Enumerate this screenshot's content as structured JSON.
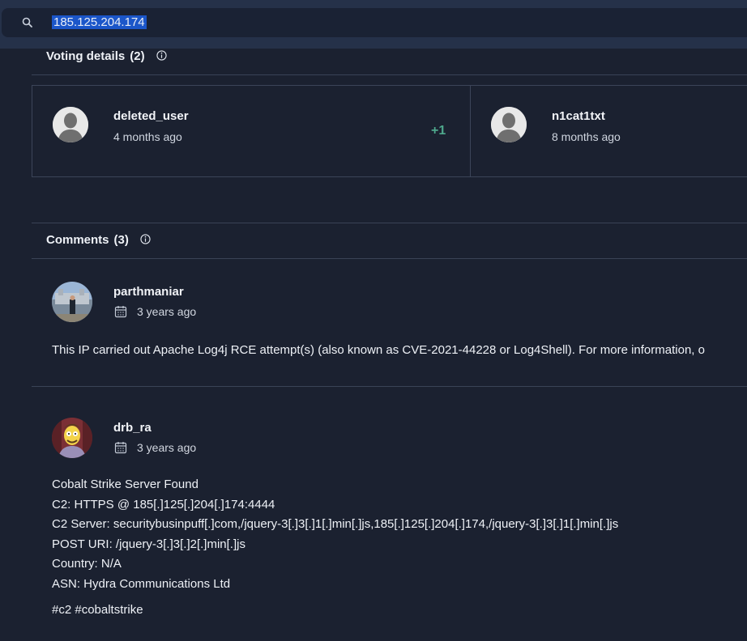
{
  "search": {
    "query": "185.125.204.174"
  },
  "voting": {
    "title": "Voting details",
    "count": "(2)",
    "cards": [
      {
        "user": "deleted_user",
        "time": "4 months ago",
        "score": "+1"
      },
      {
        "user": "n1cat1txt",
        "time": "8 months ago",
        "score": ""
      }
    ]
  },
  "comments": {
    "title": "Comments",
    "count": "(3)",
    "items": [
      {
        "user": "parthmaniar",
        "time": "3 years ago",
        "body": [
          "This IP carried out Apache Log4j RCE attempt(s) (also known as CVE-2021-44228 or Log4Shell). For more information, o"
        ]
      },
      {
        "user": "drb_ra",
        "time": "3 years ago",
        "body": [
          "Cobalt Strike Server Found",
          "C2: HTTPS @ 185[.]125[.]204[.]174:4444",
          "C2 Server: securitybusinpuff[.]com,/jquery-3[.]3[.]1[.]min[.]js,185[.]125[.]204[.]174,/jquery-3[.]3[.]1[.]min[.]js",
          "POST URI: /jquery-3[.]3[.]2[.]min[.]js",
          "Country: N/A",
          "ASN: Hydra Communications Ltd"
        ],
        "tags": "#c2 #cobaltstrike"
      }
    ]
  }
}
